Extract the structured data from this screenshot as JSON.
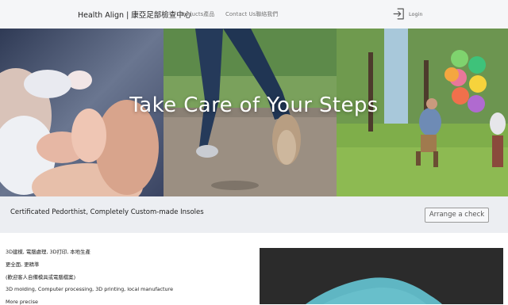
{
  "header": {
    "brand": "Health Align | 康亞足部檢查中心",
    "nav": {
      "products": "Products產品",
      "contact": "Contact Us聯絡我們"
    },
    "login_label": "Login",
    "login_icon": "login-icon"
  },
  "hero": {
    "title": "Take Care of Your Steps"
  },
  "banner": {
    "text": "Certificated Pedorthist, Completely Custom-made Insoles",
    "button_label": "Arrange a check"
  },
  "features": {
    "lines": [
      "3D建模, 電腦處理, 3D打印, 本地生產",
      "更全面, 更精準",
      "(歡迎客人自備模具或電腦檔案)",
      "3D molding, Computer processing, 3D printing, local manufacture",
      "More precise"
    ]
  },
  "colors": {
    "header_bg": "#f5f6f8",
    "banner_bg": "#eceef2",
    "media_bg": "#2b2b2b",
    "insole_teal": "#5fb6c3"
  }
}
